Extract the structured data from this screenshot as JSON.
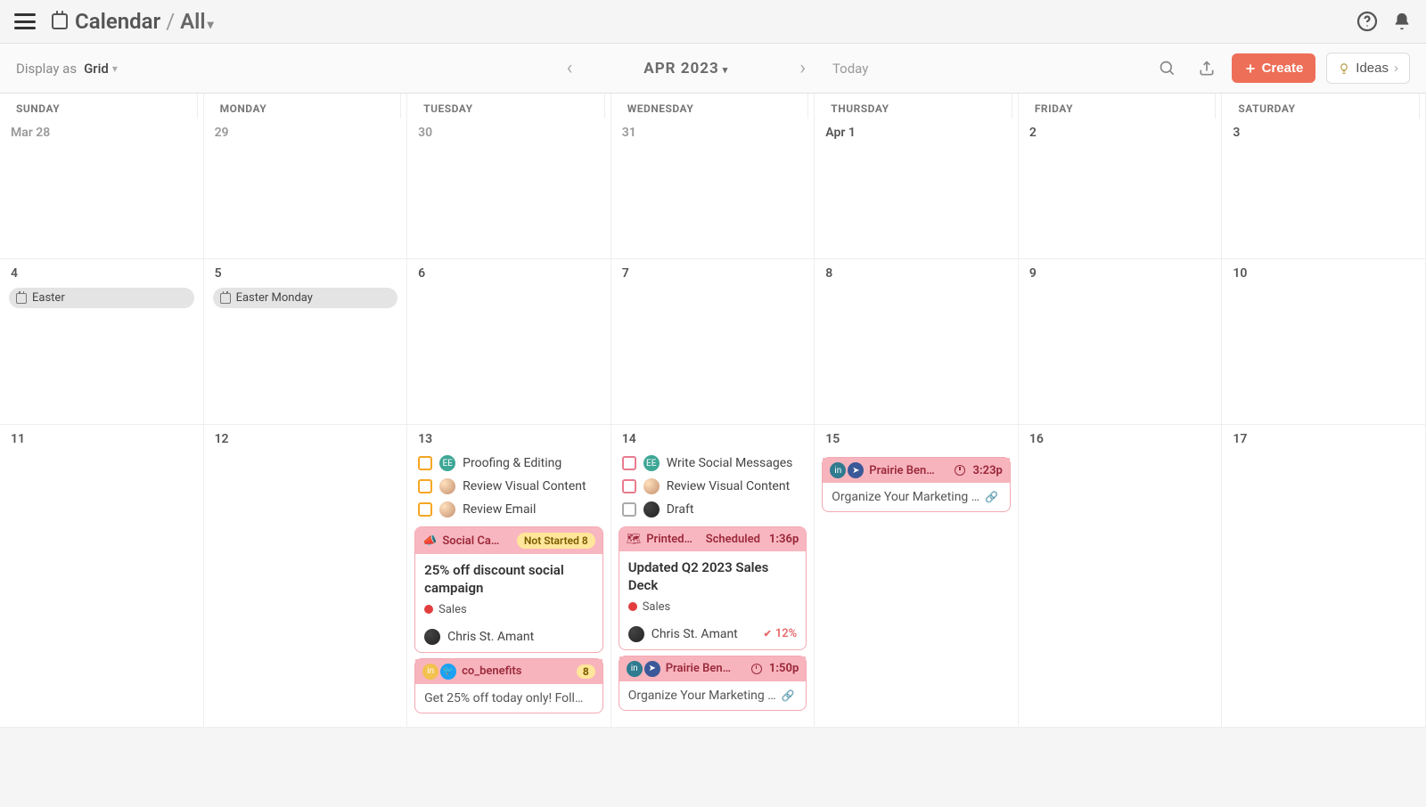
{
  "header": {
    "app_title": "Calendar",
    "breadcrumb_sub": "All"
  },
  "toolbar": {
    "display_as_label": "Display as",
    "display_as_value": "Grid",
    "month_label": "APR 2023",
    "today_label": "Today",
    "create_label": "Create",
    "ideas_label": "Ideas"
  },
  "day_headers": [
    "SUNDAY",
    "MONDAY",
    "TUESDAY",
    "WEDNESDAY",
    "THURSDAY",
    "FRIDAY",
    "SATURDAY"
  ],
  "week1": [
    "Mar 28",
    "29",
    "30",
    "31",
    "Apr 1",
    "2",
    "3"
  ],
  "week2": [
    "4",
    "5",
    "6",
    "7",
    "8",
    "9",
    "10"
  ],
  "week3": [
    "11",
    "12",
    "13",
    "14",
    "15",
    "16",
    "17"
  ],
  "holidays": {
    "easter": "Easter",
    "easter_monday": "Easter Monday"
  },
  "tasks_13": {
    "t1": "Proofing & Editing",
    "t2": "Review Visual Content",
    "t3": "Review Email"
  },
  "tasks_14": {
    "t1": "Write Social Messages",
    "t2": "Review Visual Content",
    "t3": "Draft"
  },
  "card_13": {
    "type": "Social Ca…",
    "status": "Not Started",
    "status_count": "8",
    "title": "25% off discount social campaign",
    "tag": "Sales",
    "assignee": "Chris St. Amant"
  },
  "small_13": {
    "handle": "co_benefits",
    "count": "8",
    "body": "Get 25% off today only! Foll…"
  },
  "card_14": {
    "type": "Printed…",
    "status": "Scheduled",
    "time": "1:36p",
    "title": "Updated Q2 2023 Sales Deck",
    "tag": "Sales",
    "assignee": "Chris St. Amant",
    "progress": "12%"
  },
  "small_14": {
    "handle": "Prairie Ben…",
    "time": "1:50p",
    "body": "Organize Your Marketing …"
  },
  "small_15": {
    "handle": "Prairie Ben…",
    "time": "3:23p",
    "body": "Organize Your Marketing …"
  }
}
